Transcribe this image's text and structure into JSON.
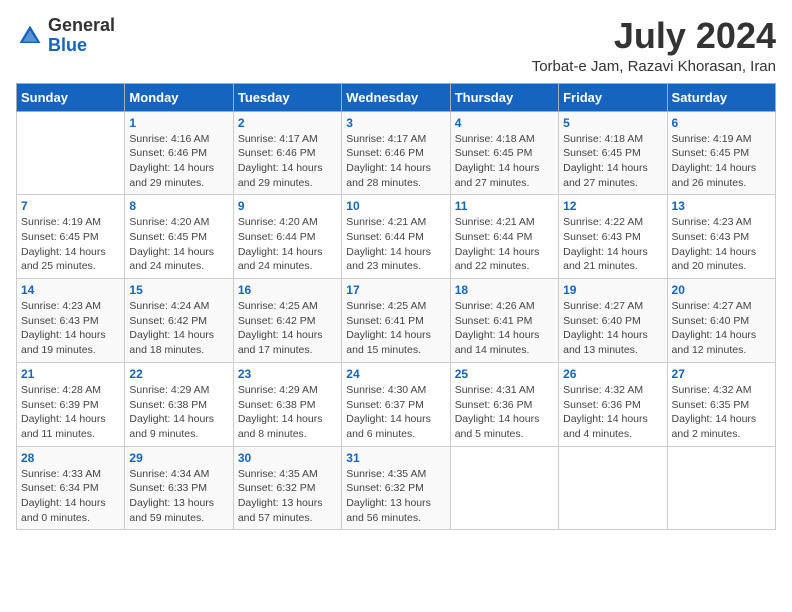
{
  "header": {
    "logo_general": "General",
    "logo_blue": "Blue",
    "month_title": "July 2024",
    "location": "Torbat-e Jam, Razavi Khorasan, Iran"
  },
  "days_of_week": [
    "Sunday",
    "Monday",
    "Tuesday",
    "Wednesday",
    "Thursday",
    "Friday",
    "Saturday"
  ],
  "weeks": [
    [
      {
        "day": "",
        "content": ""
      },
      {
        "day": "1",
        "content": "Sunrise: 4:16 AM\nSunset: 6:46 PM\nDaylight: 14 hours\nand 29 minutes."
      },
      {
        "day": "2",
        "content": "Sunrise: 4:17 AM\nSunset: 6:46 PM\nDaylight: 14 hours\nand 29 minutes."
      },
      {
        "day": "3",
        "content": "Sunrise: 4:17 AM\nSunset: 6:46 PM\nDaylight: 14 hours\nand 28 minutes."
      },
      {
        "day": "4",
        "content": "Sunrise: 4:18 AM\nSunset: 6:45 PM\nDaylight: 14 hours\nand 27 minutes."
      },
      {
        "day": "5",
        "content": "Sunrise: 4:18 AM\nSunset: 6:45 PM\nDaylight: 14 hours\nand 27 minutes."
      },
      {
        "day": "6",
        "content": "Sunrise: 4:19 AM\nSunset: 6:45 PM\nDaylight: 14 hours\nand 26 minutes."
      }
    ],
    [
      {
        "day": "7",
        "content": "Sunrise: 4:19 AM\nSunset: 6:45 PM\nDaylight: 14 hours\nand 25 minutes."
      },
      {
        "day": "8",
        "content": "Sunrise: 4:20 AM\nSunset: 6:45 PM\nDaylight: 14 hours\nand 24 minutes."
      },
      {
        "day": "9",
        "content": "Sunrise: 4:20 AM\nSunset: 6:44 PM\nDaylight: 14 hours\nand 24 minutes."
      },
      {
        "day": "10",
        "content": "Sunrise: 4:21 AM\nSunset: 6:44 PM\nDaylight: 14 hours\nand 23 minutes."
      },
      {
        "day": "11",
        "content": "Sunrise: 4:21 AM\nSunset: 6:44 PM\nDaylight: 14 hours\nand 22 minutes."
      },
      {
        "day": "12",
        "content": "Sunrise: 4:22 AM\nSunset: 6:43 PM\nDaylight: 14 hours\nand 21 minutes."
      },
      {
        "day": "13",
        "content": "Sunrise: 4:23 AM\nSunset: 6:43 PM\nDaylight: 14 hours\nand 20 minutes."
      }
    ],
    [
      {
        "day": "14",
        "content": "Sunrise: 4:23 AM\nSunset: 6:43 PM\nDaylight: 14 hours\nand 19 minutes."
      },
      {
        "day": "15",
        "content": "Sunrise: 4:24 AM\nSunset: 6:42 PM\nDaylight: 14 hours\nand 18 minutes."
      },
      {
        "day": "16",
        "content": "Sunrise: 4:25 AM\nSunset: 6:42 PM\nDaylight: 14 hours\nand 17 minutes."
      },
      {
        "day": "17",
        "content": "Sunrise: 4:25 AM\nSunset: 6:41 PM\nDaylight: 14 hours\nand 15 minutes."
      },
      {
        "day": "18",
        "content": "Sunrise: 4:26 AM\nSunset: 6:41 PM\nDaylight: 14 hours\nand 14 minutes."
      },
      {
        "day": "19",
        "content": "Sunrise: 4:27 AM\nSunset: 6:40 PM\nDaylight: 14 hours\nand 13 minutes."
      },
      {
        "day": "20",
        "content": "Sunrise: 4:27 AM\nSunset: 6:40 PM\nDaylight: 14 hours\nand 12 minutes."
      }
    ],
    [
      {
        "day": "21",
        "content": "Sunrise: 4:28 AM\nSunset: 6:39 PM\nDaylight: 14 hours\nand 11 minutes."
      },
      {
        "day": "22",
        "content": "Sunrise: 4:29 AM\nSunset: 6:38 PM\nDaylight: 14 hours\nand 9 minutes."
      },
      {
        "day": "23",
        "content": "Sunrise: 4:29 AM\nSunset: 6:38 PM\nDaylight: 14 hours\nand 8 minutes."
      },
      {
        "day": "24",
        "content": "Sunrise: 4:30 AM\nSunset: 6:37 PM\nDaylight: 14 hours\nand 6 minutes."
      },
      {
        "day": "25",
        "content": "Sunrise: 4:31 AM\nSunset: 6:36 PM\nDaylight: 14 hours\nand 5 minutes."
      },
      {
        "day": "26",
        "content": "Sunrise: 4:32 AM\nSunset: 6:36 PM\nDaylight: 14 hours\nand 4 minutes."
      },
      {
        "day": "27",
        "content": "Sunrise: 4:32 AM\nSunset: 6:35 PM\nDaylight: 14 hours\nand 2 minutes."
      }
    ],
    [
      {
        "day": "28",
        "content": "Sunrise: 4:33 AM\nSunset: 6:34 PM\nDaylight: 14 hours\nand 0 minutes."
      },
      {
        "day": "29",
        "content": "Sunrise: 4:34 AM\nSunset: 6:33 PM\nDaylight: 13 hours\nand 59 minutes."
      },
      {
        "day": "30",
        "content": "Sunrise: 4:35 AM\nSunset: 6:32 PM\nDaylight: 13 hours\nand 57 minutes."
      },
      {
        "day": "31",
        "content": "Sunrise: 4:35 AM\nSunset: 6:32 PM\nDaylight: 13 hours\nand 56 minutes."
      },
      {
        "day": "",
        "content": ""
      },
      {
        "day": "",
        "content": ""
      },
      {
        "day": "",
        "content": ""
      }
    ]
  ]
}
